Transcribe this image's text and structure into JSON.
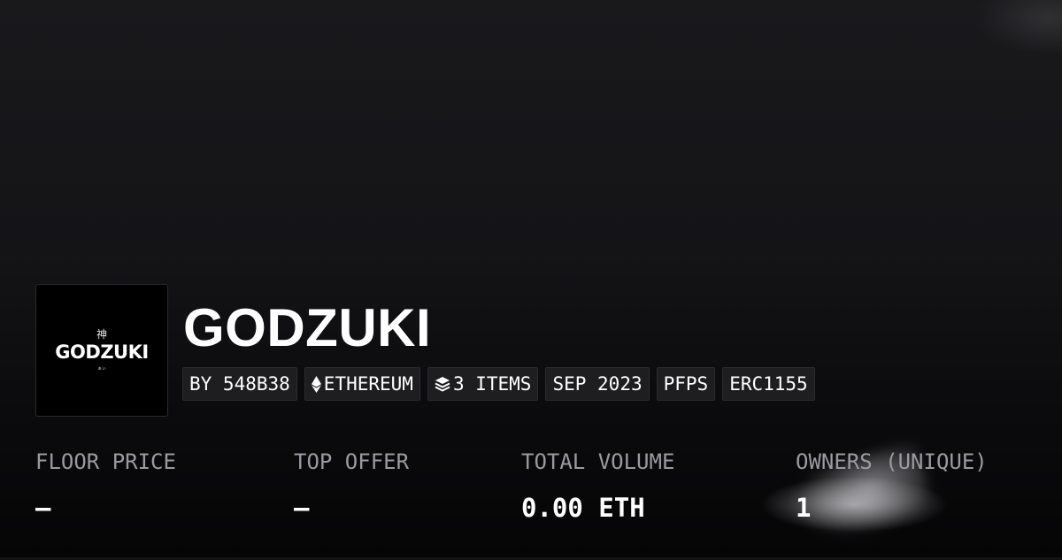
{
  "collection": {
    "logo": {
      "kanji": "神",
      "wordmark": "GODZUKI",
      "sub": "ぁぃ"
    },
    "title": "GODZUKI",
    "tags": [
      {
        "label": "BY 548B38",
        "icon": ""
      },
      {
        "label": "ETHEREUM",
        "icon": "ethereum-icon"
      },
      {
        "label": "3 ITEMS",
        "icon": "layers-icon"
      },
      {
        "label": "SEP 2023",
        "icon": ""
      },
      {
        "label": "PFPS",
        "icon": ""
      },
      {
        "label": "ERC1155",
        "icon": ""
      }
    ]
  },
  "stats": [
    {
      "label": "FLOOR PRICE",
      "value": "–"
    },
    {
      "label": "TOP OFFER",
      "value": "–"
    },
    {
      "label": "TOTAL VOLUME",
      "value": "0.00 ETH"
    },
    {
      "label": "OWNERS (UNIQUE)",
      "value": "1"
    }
  ],
  "colors": {
    "background": "#121215",
    "tag_background": "#1e1e21",
    "label_gray": "#9a9aa0",
    "text": "#ffffff"
  }
}
